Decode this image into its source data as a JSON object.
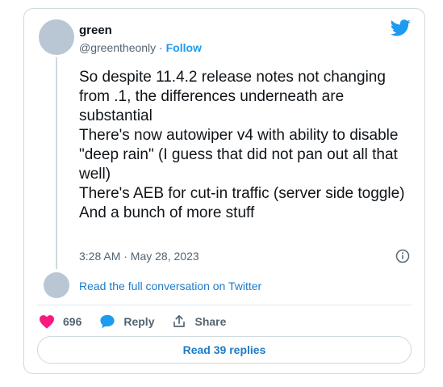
{
  "author": {
    "name": "green",
    "handle": "@greentheonly",
    "separator": " · ",
    "follow_label": "Follow"
  },
  "tweet": {
    "lines": [
      "So despite 11.4.2 release notes not changing from .1, the differences underneath are substantial",
      "There's now autowiper v4 with ability to disable \"deep rain\" (I guess that did not pan out all that well)",
      "There's AEB for cut-in traffic (server side toggle)",
      "And a bunch of more stuff"
    ],
    "timestamp": "3:28 AM · May 28, 2023"
  },
  "thread": {
    "read_full_label": "Read the full conversation on Twitter"
  },
  "actions": {
    "like_count": "696",
    "reply_label": "Reply",
    "share_label": "Share",
    "read_replies_label": "Read 39 replies"
  },
  "colors": {
    "accent": "#1d9bf0",
    "link": "#1d7bc9",
    "like": "#f91880",
    "secondary_text": "#536471",
    "border": "#cfd9de"
  },
  "icons": [
    "twitter-bird-icon",
    "info-icon",
    "heart-icon",
    "reply-bubble-icon",
    "share-icon"
  ]
}
